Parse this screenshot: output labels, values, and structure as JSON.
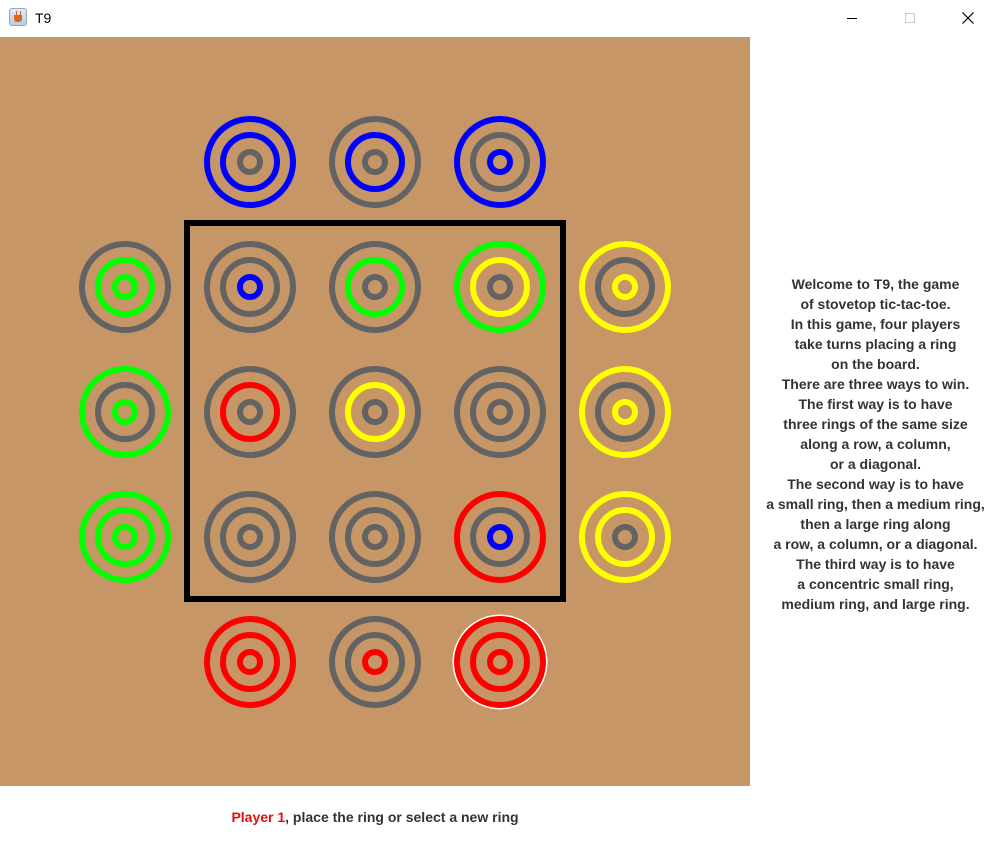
{
  "window": {
    "title": "T9",
    "app_icon": "java-cup-icon",
    "controls": [
      "minimize-icon",
      "maximize-icon",
      "close-icon"
    ]
  },
  "board": {
    "background": "#c69666",
    "frame_color": "#000000",
    "colors": {
      "gray": "#636363",
      "blue": "#0000ff",
      "green": "#00ff00",
      "yellow": "#ffff00",
      "red": "#ff0000"
    },
    "reserves": {
      "top_blue": [
        [
          "blue",
          "blue",
          "gray"
        ],
        [
          "gray",
          "blue",
          "gray"
        ],
        [
          "blue",
          "gray",
          "blue"
        ]
      ],
      "left_green": [
        [
          "gray",
          "green",
          "green"
        ],
        [
          "green",
          "gray",
          "green"
        ],
        [
          "green",
          "green",
          "green"
        ]
      ],
      "right_yellow": [
        [
          "yellow",
          "gray",
          "yellow"
        ],
        [
          "yellow",
          "gray",
          "yellow"
        ],
        [
          "yellow",
          "yellow",
          "gray"
        ]
      ],
      "bottom_red": [
        [
          "red",
          "red",
          "red"
        ],
        [
          "gray",
          "gray",
          "red"
        ],
        [
          "red",
          "red",
          "red"
        ]
      ]
    },
    "grid": [
      [
        [
          "gray",
          "gray",
          "blue"
        ],
        [
          "gray",
          "green",
          "gray"
        ],
        [
          "green",
          "yellow",
          "gray"
        ]
      ],
      [
        [
          "gray",
          "red",
          "gray"
        ],
        [
          "gray",
          "yellow",
          "gray"
        ],
        [
          "gray",
          "gray",
          "gray"
        ]
      ],
      [
        [
          "gray",
          "gray",
          "gray"
        ],
        [
          "gray",
          "gray",
          "gray"
        ],
        [
          "red",
          "gray",
          "blue"
        ]
      ]
    ],
    "selected_piece": "bottom_red.2"
  },
  "rules_text": [
    "Welcome to T9, the game",
    "of stovetop tic-tac-toe.",
    "In this game, four players",
    "take turns placing a ring",
    "on the board.",
    "There are three ways to win.",
    "The first way is to have",
    "three rings of the same size",
    "along a row, a column,",
    "or a diagonal.",
    "The second way is to have",
    "a small ring, then a medium ring,",
    "then a large ring along",
    "a row, a column, or a diagonal.",
    "The third way is to have",
    "a concentric small ring,",
    "medium ring, and large ring."
  ],
  "status": {
    "player": "Player 1",
    "message": ", place the ring or select a new ring",
    "player_color": "#e01010"
  }
}
